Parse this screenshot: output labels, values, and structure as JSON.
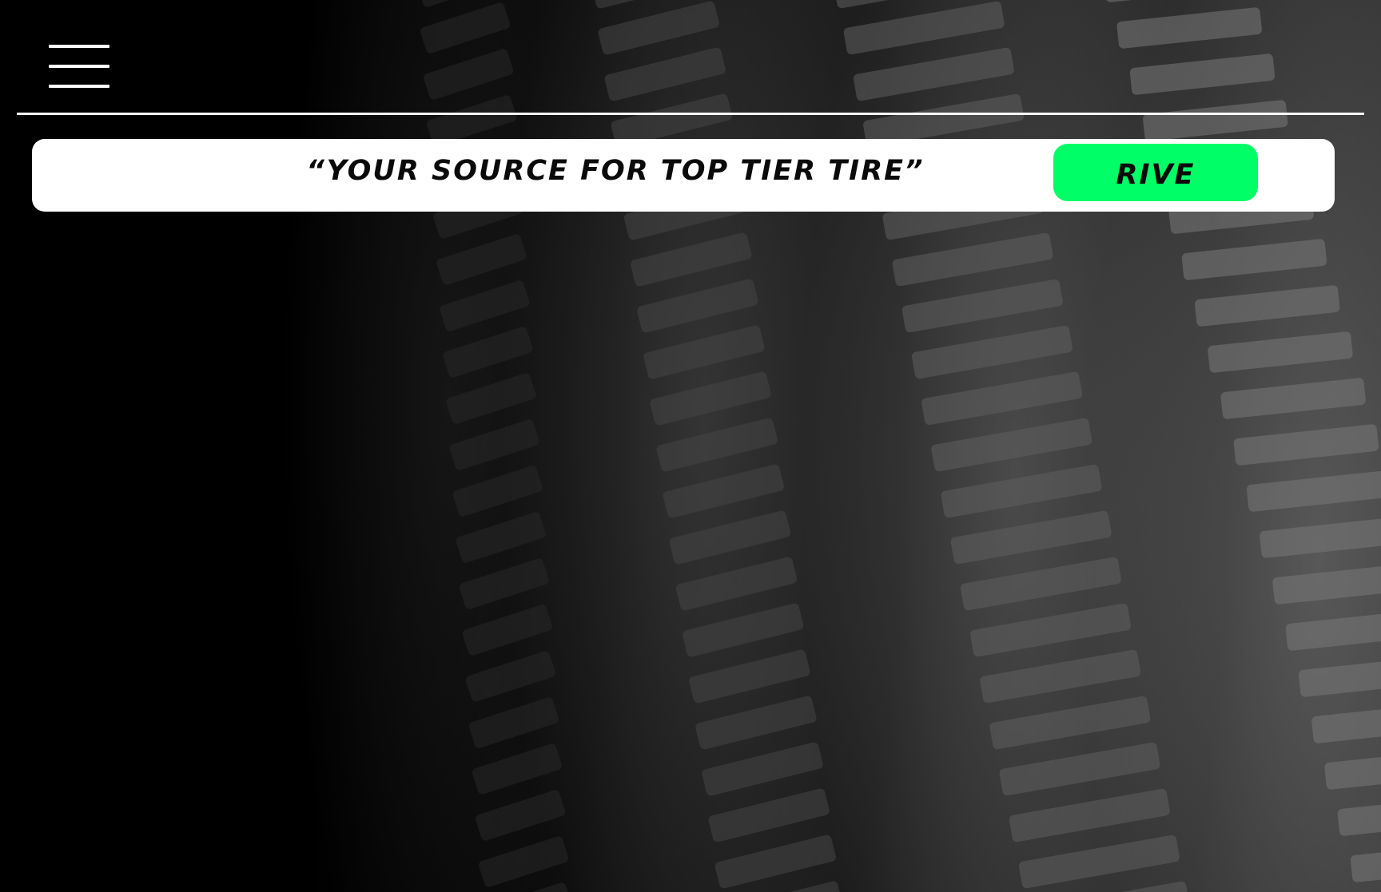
{
  "header": {
    "menu_icon": "hamburger-menu-icon"
  },
  "banner": {
    "tagline": "“YOUR SOURCE FOR TOP TIER TIRE”",
    "cta_label": "RIVE"
  },
  "hero": {
    "image_subject": "close-up of stacked black tire treads"
  },
  "colors": {
    "background": "#000000",
    "banner": "#ffffff",
    "accent": "#00ff66",
    "text": "#0a0a0a",
    "divider": "#ffffff"
  }
}
